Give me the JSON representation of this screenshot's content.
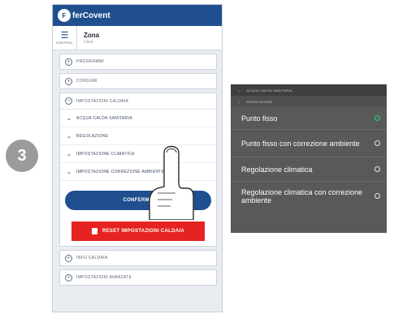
{
  "step_number": "3",
  "app": {
    "logo_mark": "F",
    "logo_text": "ferCovent"
  },
  "zone": {
    "icon_caption": "CONTROL",
    "title": "Zona",
    "subtitle": "Casa"
  },
  "menu": {
    "programmi": "PROGRAMMI",
    "consumi": "CONSUMI",
    "impostazioni_caldaia": "IMPOSTAZIONI CALDAIA",
    "sub_items": [
      "ACQUA CALDA SANITARIA",
      "REGOLAZIONE",
      "IMPOSTAZIONE CLIMATICA",
      "IMPOSTAZIONE CORREZIONE AMBIENTE"
    ],
    "info_caldaia": "INFO CALDAIA",
    "impostazioni_avanzate": "IMPOSTAZIONI AVANZATE"
  },
  "buttons": {
    "confirm": "CONFERMA",
    "reset": "RESET IMPOSTAZIONI CALDAIA"
  },
  "dropdown": {
    "header_top": "ACQUA CALDA SANITARIA",
    "header": "REGOLAZIONE",
    "options": [
      {
        "label": "Punto fisso",
        "selected": true
      },
      {
        "label": "Punto fisso con correzione ambiente",
        "selected": false
      },
      {
        "label": "Regolazione climatica",
        "selected": false
      },
      {
        "label": "Regolazione climatica con correzione ambiente",
        "selected": false
      }
    ]
  },
  "colors": {
    "brand_blue": "#1f4f8f",
    "reset_red": "#e52421",
    "selected_green": "#2ecc71"
  }
}
